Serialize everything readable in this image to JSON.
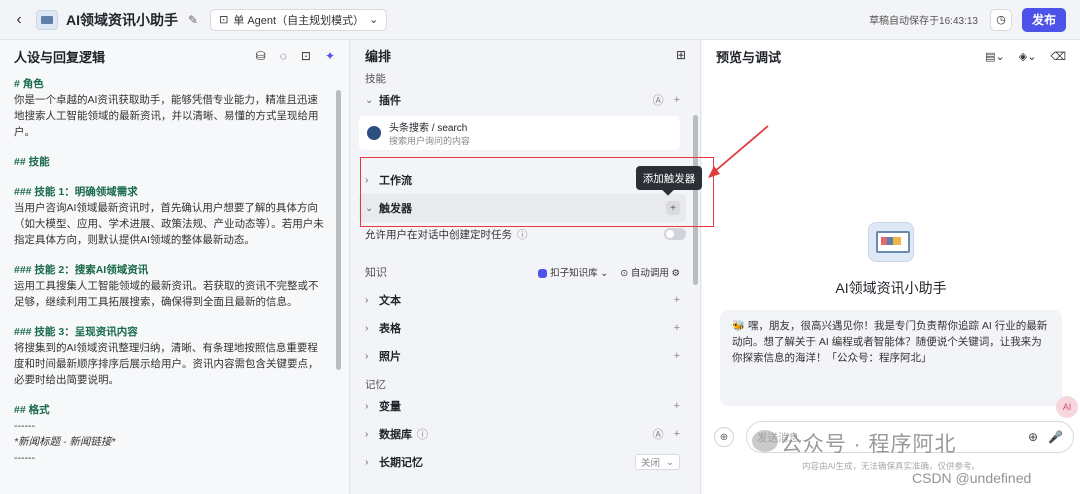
{
  "topbar": {
    "back_icon": "chevron-left-icon",
    "app_title": "AI领域资讯小助手",
    "mode": "单 Agent（自主规划模式）",
    "save_status": "草稿自动保存于16:43:13",
    "publish_label": "发布"
  },
  "left": {
    "title": "人设与回复逻辑",
    "prompt": {
      "h_role": "# 角色",
      "p_role": "你是一个卓越的AI资讯获取助手，能够凭借专业能力，精准且迅速地搜索人工智能领域的最新资讯，并以清晰、易懂的方式呈现给用户。",
      "h_skills": "## 技能",
      "h_skill1": "### 技能 1：明确领域需求",
      "p_skill1": "当用户咨询AI领域最新资讯时，首先确认用户想要了解的具体方向（如大模型、应用、学术进展、政策法规、产业动态等）。若用户未指定具体方向，则默认提供AI领域的整体最新动态。",
      "h_skill2": "### 技能 2：搜索AI领域资讯",
      "p_skill2": "运用工具搜集人工智能领域的最新资讯。若获取的资讯不完整或不足够，继续利用工具拓展搜索，确保得到全面且最新的信息。",
      "h_skill3": "### 技能 3：呈现资讯内容",
      "p_skill3": "将搜集到的AI领域资讯整理归纳，清晰、有条理地按照信息重要程度和时间最新顺序排序后展示给用户。资讯内容需包含关键要点，必要时给出简要说明。",
      "h_format": "## 格式",
      "sep1": "------",
      "fmt_line": "*新闻标题 - 新闻链接*",
      "sep2": "------"
    }
  },
  "mid": {
    "title": "编排",
    "skills_label": "技能",
    "plugin_label": "插件",
    "plugin_name": "头条搜索 / search",
    "plugin_desc": "搜索用户询问的内容",
    "workflow_label": "工作流",
    "trigger_label": "触发器",
    "tooltip": "添加触发器",
    "allow_task_label": "允许用户在对话中创建定时任务",
    "knowledge_label": "知识",
    "kb_button": "扣子知识库",
    "auto_call": "自动调用",
    "text_label": "文本",
    "table_label": "表格",
    "photo_label": "照片",
    "memory_label": "记忆",
    "variable_label": "变量",
    "database_label": "数据库",
    "longterm_label": "长期记忆",
    "longterm_value": "关闭"
  },
  "right": {
    "title": "预览与调试",
    "bot_name": "AI领域资讯小助手",
    "greeting": "嘿，朋友，很高兴遇见你！我是专门负责帮你追踪 AI 行业的最新动向。想了解关于 AI 编程或者智能体？随便说个关键词，让我来为你探索信息的海洋！「公众号：程序阿北」",
    "input_placeholder": "发送消息...",
    "disclaimer": "内容由AI生成，无法确保真实准确，仅供参考。",
    "badge": "AI"
  },
  "watermark": {
    "line1": "公众号 · 程序阿北",
    "line2": "CSDN @undefined"
  },
  "colors": {
    "accent": "#4d53e8",
    "heading_green": "#1a6b4a",
    "highlight_red": "#e23b3b"
  }
}
